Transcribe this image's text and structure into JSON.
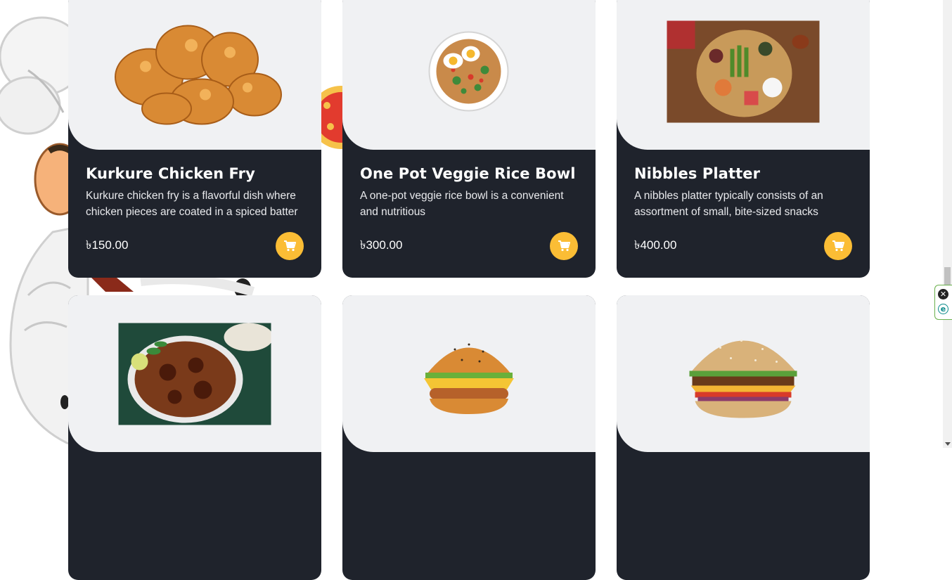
{
  "colors": {
    "card_dark": "#1f232c",
    "card_light": "#f0f1f3",
    "accent": "#fbbd35"
  },
  "cart_icon": "shopping-cart-icon",
  "products": [
    {
      "title": "Kurkure Chicken Fry",
      "description": "Kurkure chicken fry is a flavorful dish where chicken pieces are coated in a spiced batter",
      "price": "৳150.00",
      "image": "fried-chicken-image"
    },
    {
      "title": "One Pot Veggie Rice Bowl",
      "description": "A one-pot veggie rice bowl is a convenient and nutritious",
      "price": "৳300.00",
      "image": "rice-bowl-image"
    },
    {
      "title": "Nibbles Platter",
      "description": "A nibbles platter typically consists of an assortment of small, bite-sized snacks",
      "price": "৳400.00",
      "image": "platter-image"
    },
    {
      "title": "",
      "description": "",
      "price": "",
      "image": "chicken-curry-image"
    },
    {
      "title": "",
      "description": "",
      "price": "",
      "image": "chicken-burger-image"
    },
    {
      "title": "",
      "description": "",
      "price": "",
      "image": "beef-burger-image"
    }
  ]
}
